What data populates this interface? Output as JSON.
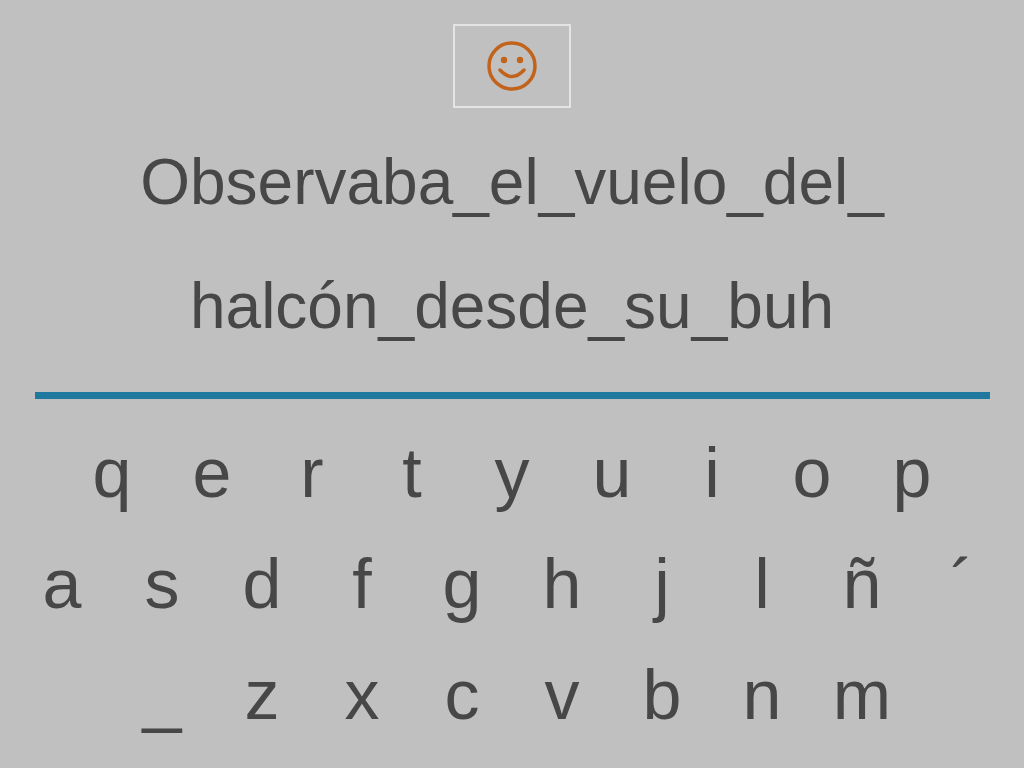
{
  "sentence_lines": [
    "Observaba_el_vuelo_del_",
    "halcón_desde_su_buh"
  ],
  "keyboard": [
    [
      "q",
      "e",
      "r",
      "t",
      "y",
      "u",
      "i",
      "o",
      "p"
    ],
    [
      "a",
      "s",
      "d",
      "f",
      "g",
      "h",
      "j",
      "l",
      "ñ",
      "´"
    ],
    [
      "_",
      "z",
      "x",
      "c",
      "v",
      "b",
      "n",
      "m"
    ]
  ]
}
